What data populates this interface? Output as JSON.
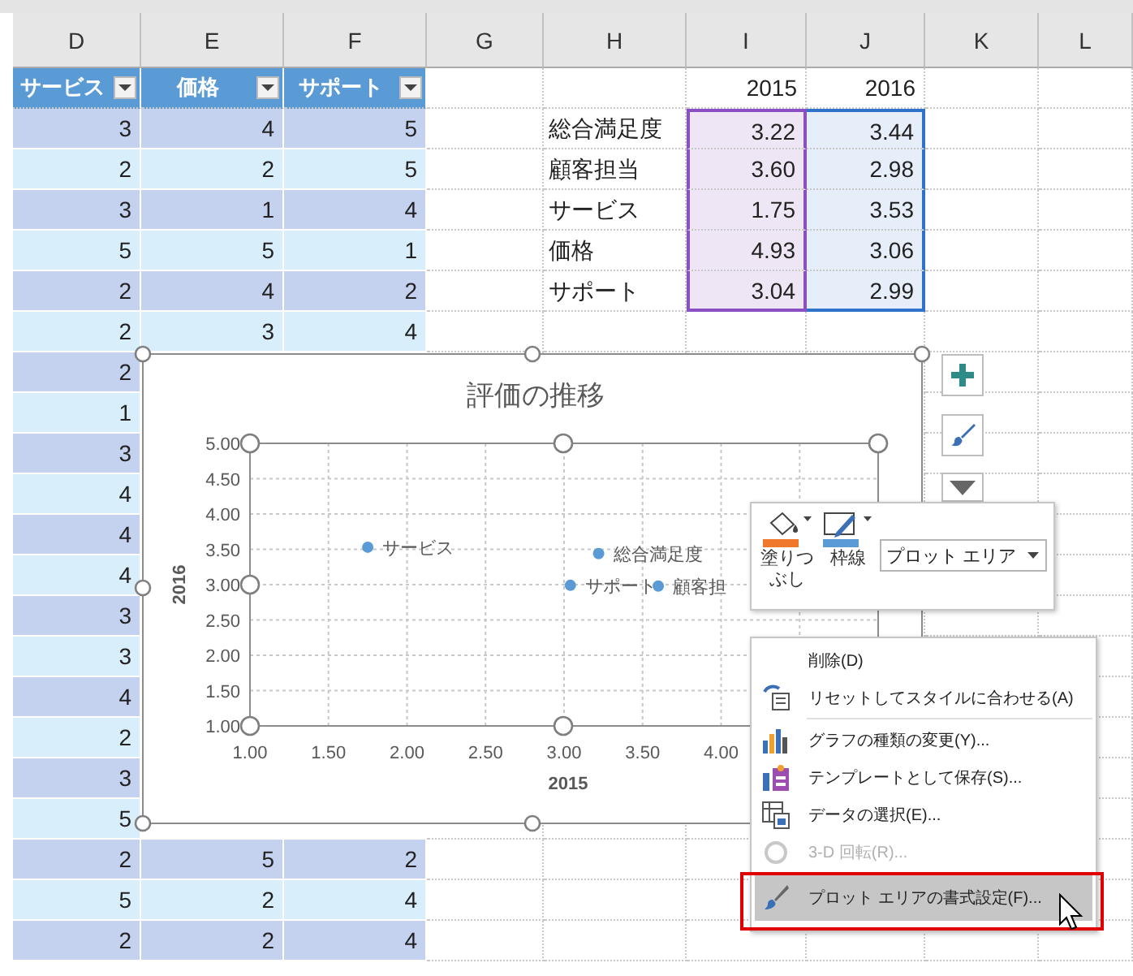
{
  "columns": [
    "D",
    "E",
    "F",
    "G",
    "H",
    "I",
    "J",
    "K",
    "L"
  ],
  "table": {
    "headers": [
      "サービス",
      "価格",
      "サポート"
    ],
    "rows": [
      {
        "cells": [
          "3",
          "4",
          "5"
        ]
      },
      {
        "cells": [
          "2",
          "2",
          "5"
        ]
      },
      {
        "cells": [
          "3",
          "1",
          "4"
        ]
      },
      {
        "cells": [
          "5",
          "5",
          "1"
        ]
      },
      {
        "cells": [
          "2",
          "4",
          "2"
        ]
      },
      {
        "cells": [
          "2",
          "3",
          "4"
        ]
      },
      {
        "cells": [
          "2"
        ]
      },
      {
        "cells": [
          "1"
        ]
      },
      {
        "cells": [
          "3"
        ]
      },
      {
        "cells": [
          "4"
        ]
      },
      {
        "cells": [
          "4"
        ]
      },
      {
        "cells": [
          "4"
        ]
      },
      {
        "cells": [
          "3"
        ]
      },
      {
        "cells": [
          "3"
        ]
      },
      {
        "cells": [
          "4"
        ]
      },
      {
        "cells": [
          "2"
        ]
      },
      {
        "cells": [
          "3"
        ]
      },
      {
        "cells": [
          "5"
        ]
      },
      {
        "cells": [
          "2",
          "5",
          "2"
        ]
      },
      {
        "cells": [
          "5",
          "2",
          "4"
        ]
      },
      {
        "cells": [
          "2",
          "2",
          "4"
        ]
      }
    ]
  },
  "summary": {
    "years": [
      "2015",
      "2016"
    ],
    "rows": [
      {
        "label": "総合満足度",
        "values": [
          "3.22",
          "3.44"
        ]
      },
      {
        "label": "顧客担当",
        "values": [
          "3.60",
          "2.98"
        ]
      },
      {
        "label": "サービス",
        "values": [
          "1.75",
          "3.53"
        ]
      },
      {
        "label": "価格",
        "values": [
          "4.93",
          "3.06"
        ]
      },
      {
        "label": "サポート",
        "values": [
          "3.04",
          "2.99"
        ]
      }
    ]
  },
  "chart": {
    "chart_data": {
      "type": "scatter",
      "title": "評価の推移",
      "xlabel": "2015",
      "ylabel": "2016",
      "x": [
        1.75,
        3.22,
        3.04,
        3.6
      ],
      "series": [
        {
          "color": "#5b9bd5",
          "values": [
            3.53,
            3.44,
            2.99,
            2.98
          ]
        }
      ],
      "grid": true,
      "xlim": [
        1,
        5
      ],
      "ylim": [
        1,
        5
      ],
      "xticks": [
        {
          "value": 1,
          "label": "1.00"
        },
        {
          "value": 1.5,
          "label": "1.50"
        },
        {
          "value": 2,
          "label": "2.00"
        },
        {
          "value": 2.5,
          "label": "2.50"
        },
        {
          "value": 3,
          "label": "3.00"
        },
        {
          "value": 3.5,
          "label": "3.50"
        },
        {
          "value": 4,
          "label": "4.00"
        }
      ],
      "yticks": [
        {
          "value": 1,
          "label": "1.00"
        },
        {
          "value": 1.5,
          "label": "1.50"
        },
        {
          "value": 2,
          "label": "2.00"
        },
        {
          "value": 2.5,
          "label": "2.50"
        },
        {
          "value": 3,
          "label": "3.00"
        },
        {
          "value": 3.5,
          "label": "3.50"
        },
        {
          "value": 4,
          "label": "4.00"
        },
        {
          "value": 4.5,
          "label": "4.50"
        },
        {
          "value": 5,
          "label": "5.00"
        }
      ],
      "annotations": [
        {
          "text": "サービス",
          "x": 1.75,
          "y": 3.53
        },
        {
          "text": "総合満足度",
          "x": 3.22,
          "y": 3.44
        },
        {
          "text": "サポート",
          "x": 3.04,
          "y": 2.99
        },
        {
          "text": "顧客担",
          "x": 3.6,
          "y": 2.98
        }
      ]
    }
  },
  "mini_toolbar": {
    "fill_label": "塗りつぶし",
    "outline_label": "枠線",
    "element": "プロット エリア"
  },
  "context_menu": [
    {
      "label": "削除(D)",
      "disabled": false,
      "selected": false
    },
    {
      "label": "リセットしてスタイルに合わせる(A)",
      "disabled": false,
      "selected": false
    },
    {
      "label": "グラフの種類の変更(Y)...",
      "disabled": false,
      "selected": false
    },
    {
      "label": "テンプレートとして保存(S)...",
      "disabled": false,
      "selected": false
    },
    {
      "label": "データの選択(E)...",
      "disabled": false,
      "selected": false
    },
    {
      "label": "3-D 回転(R)...",
      "disabled": true,
      "selected": false
    },
    {
      "label": "プロット エリアの書式設定(F)...",
      "disabled": false,
      "selected": true
    }
  ]
}
